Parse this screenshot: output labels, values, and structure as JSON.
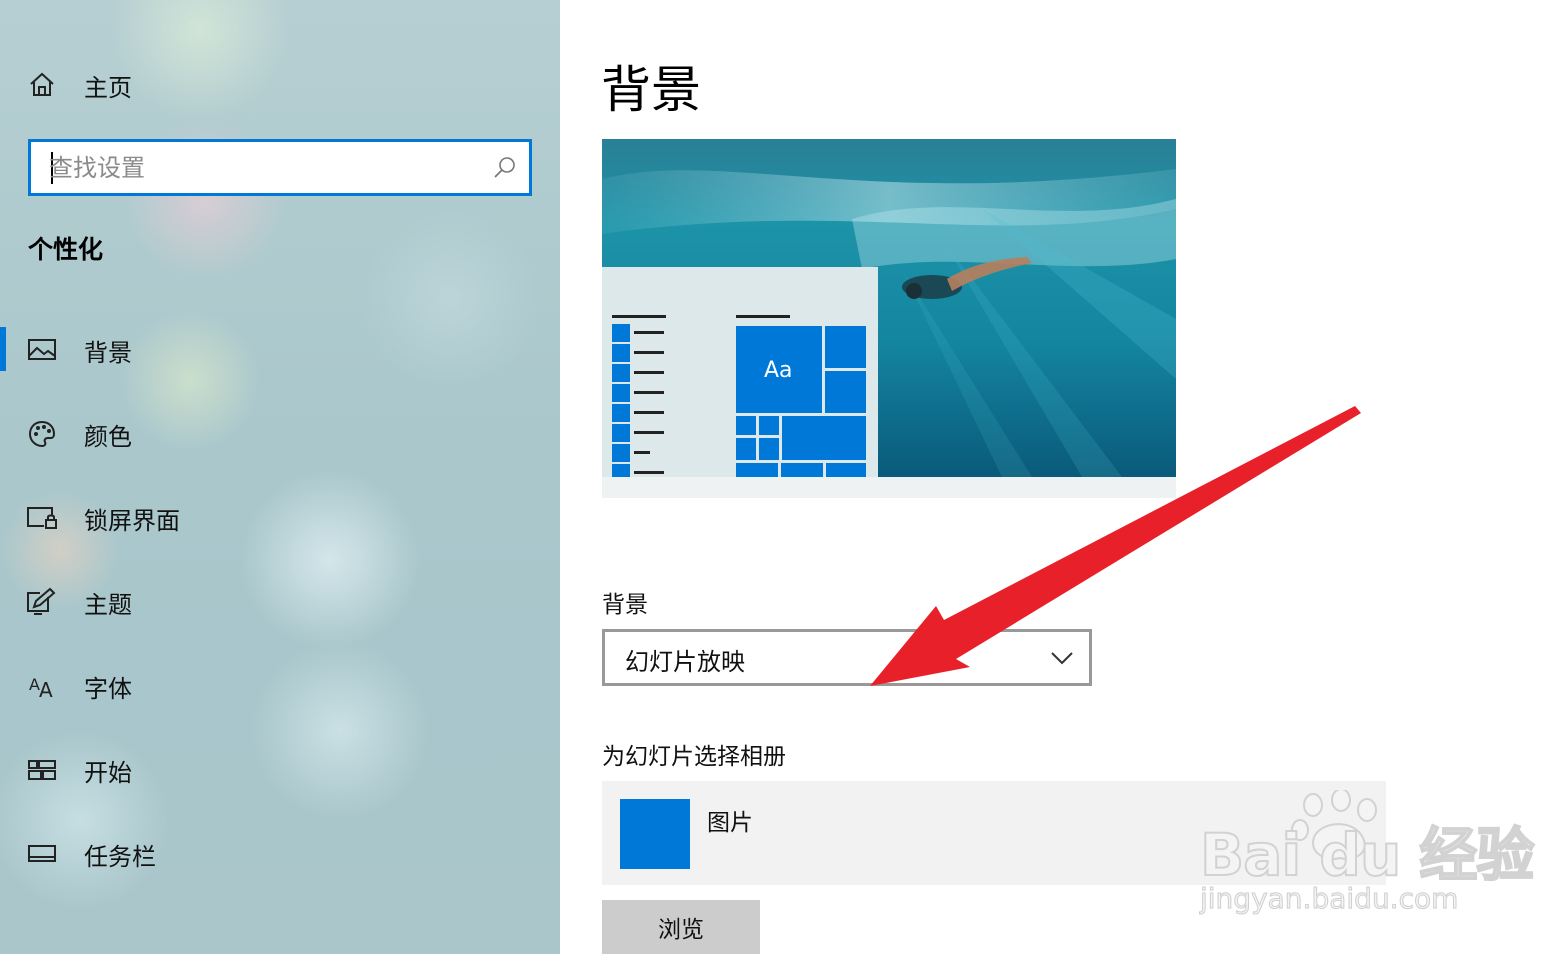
{
  "sidebar": {
    "home": {
      "label": "主页",
      "icon": "home-icon"
    },
    "search": {
      "placeholder": "查找设置",
      "icon": "search-icon"
    },
    "section_heading": "个性化",
    "items": [
      {
        "label": "背景",
        "icon": "picture-icon",
        "active": true
      },
      {
        "label": "颜色",
        "icon": "palette-icon",
        "active": false
      },
      {
        "label": "锁屏界面",
        "icon": "lock-screen-icon",
        "active": false
      },
      {
        "label": "主题",
        "icon": "theme-brush-icon",
        "active": false
      },
      {
        "label": "字体",
        "icon": "font-icon",
        "active": false
      },
      {
        "label": "开始",
        "icon": "start-tiles-icon",
        "active": false
      },
      {
        "label": "任务栏",
        "icon": "taskbar-icon",
        "active": false
      }
    ],
    "accent_color": "#0078d7"
  },
  "main": {
    "title": "背景",
    "preview": {
      "tile_text": "Aa"
    },
    "background_setting": {
      "label": "背景",
      "selected": "幻灯片放映"
    },
    "album_setting": {
      "label": "为幻灯片选择相册",
      "album_name": "图片"
    },
    "browse_label": "浏览"
  },
  "watermark": {
    "brand": "Bai du 经验",
    "url": "jingyan.baidu.com"
  },
  "annotation": {
    "arrow_color": "#e8202a"
  }
}
